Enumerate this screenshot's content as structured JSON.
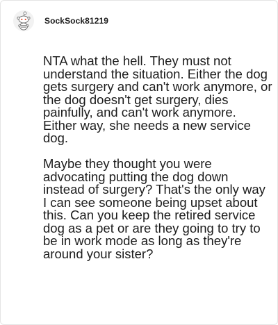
{
  "comment": {
    "username": "SockSock81219",
    "avatar_icon": "reddit-snoo-avatar-icon",
    "paragraphs": [
      "NTA what the hell. They must not understand the situation. Either the dog gets surgery and can't work anymore, or the dog doesn't get surgery, dies painfully, and can't work anymore. Either way, she needs a new service dog.",
      "Maybe they thought you were advocating putting the dog down instead of surgery? That's the only way I can see someone being upset about this. Can you keep the retired service dog as a pet or are they going to try to be in work mode as long as they're around your sister?"
    ]
  },
  "colors": {
    "text": "#1c1c1c",
    "username": "#1a1a1a",
    "border": "#e4e4e4",
    "avatar_bg": "#f2f2f2"
  }
}
